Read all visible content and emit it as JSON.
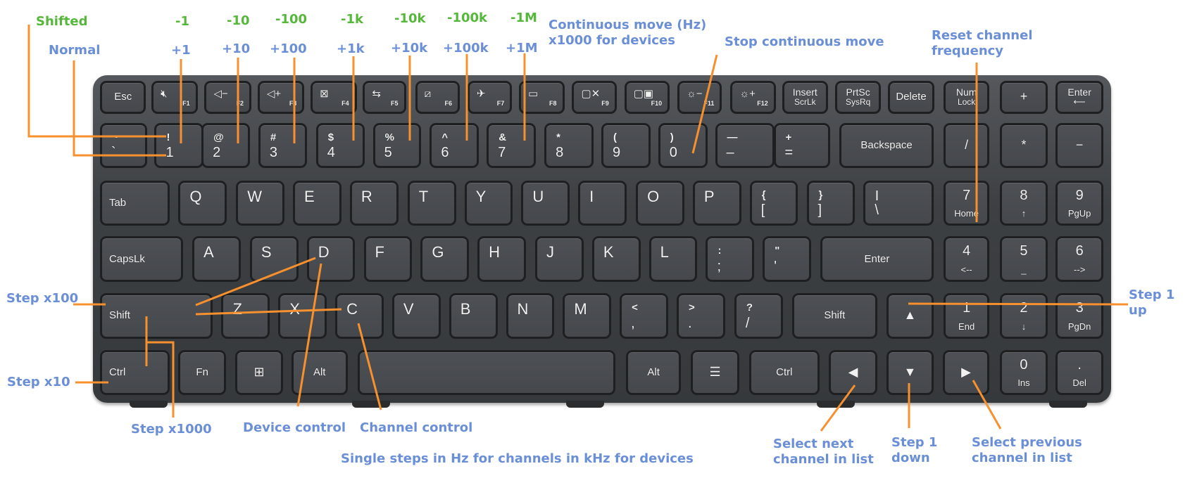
{
  "annotations": {
    "shifted": "Shifted",
    "normal": "Normal",
    "step_values_shifted": [
      "-1",
      "-10",
      "-100",
      "-1k",
      "-10k",
      "-100k",
      "-1M"
    ],
    "step_values_normal": [
      "+1",
      "+10",
      "+100",
      "+1k",
      "+10k",
      "+100k",
      "+1M"
    ],
    "continuous_move_line1": "Continuous move (Hz)",
    "continuous_move_line2": "x1000 for devices",
    "stop_continuous_move": "Stop continuous move",
    "reset_channel_line1": "Reset channel",
    "reset_channel_line2": "frequency",
    "step_x100": "Step x100",
    "step_x10": "Step x10",
    "step_x1000": "Step x1000",
    "device_control": "Device control",
    "channel_control": "Channel control",
    "single_steps": "Single steps in Hz for channels in kHz for devices",
    "select_next_line1": "Select next",
    "select_next_line2": "channel in list",
    "step1_down_line1": "Step 1",
    "step1_down_line2": "down",
    "select_prev_line1": "Select previous",
    "select_prev_line2": "channel in list",
    "step1_up_line1": "Step 1",
    "step1_up_line2": "up"
  },
  "colors": {
    "annotation_blue": "#6a8fd6",
    "annotation_green": "#55b83a",
    "leader_line_orange": "#f7902e",
    "keyboard_body": "#3d4043"
  },
  "keyboard": {
    "keys": [
      {
        "id": "esc",
        "main": "Esc"
      },
      {
        "id": "f1",
        "icon": "mute-icon",
        "glyph": "🔇︎",
        "fn": "F1"
      },
      {
        "id": "f2",
        "icon": "volume-down-icon",
        "glyph": "◁−",
        "fn": "F2"
      },
      {
        "id": "f3",
        "icon": "volume-up-icon",
        "glyph": "◁+",
        "fn": "F3"
      },
      {
        "id": "f4",
        "icon": "close-window-icon",
        "glyph": "⊠",
        "fn": "F4"
      },
      {
        "id": "f5",
        "icon": "refresh-icon",
        "glyph": "⇆",
        "fn": "F5"
      },
      {
        "id": "f6",
        "icon": "touchpad-off-icon",
        "glyph": "⧄",
        "fn": "F6"
      },
      {
        "id": "f7",
        "icon": "airplane-icon",
        "glyph": "✈",
        "fn": "F7"
      },
      {
        "id": "f8",
        "icon": "camera-icon",
        "glyph": "▭",
        "fn": "F8"
      },
      {
        "id": "f9",
        "icon": "display-off-icon",
        "glyph": "▢✕",
        "fn": "F9"
      },
      {
        "id": "f10",
        "icon": "project-display-icon",
        "glyph": "▢▣",
        "fn": "F10"
      },
      {
        "id": "f11",
        "icon": "brightness-down-icon",
        "glyph": "☼−",
        "fn": "F11"
      },
      {
        "id": "f12",
        "icon": "brightness-up-icon",
        "glyph": "☼+",
        "fn": "F12"
      },
      {
        "id": "insert",
        "top": "Insert",
        "bottom": "ScrLk"
      },
      {
        "id": "prtsc",
        "top": "PrtSc",
        "bottom": "SysRq"
      },
      {
        "id": "delete",
        "main": "Delete"
      },
      {
        "id": "numlock",
        "top": "Num",
        "bottom": "Lock"
      },
      {
        "id": "kp-plus",
        "main": "+"
      },
      {
        "id": "kp-enter",
        "top": "Enter",
        "bottom": "⟵"
      },
      {
        "id": "backtick",
        "top": "~",
        "bottom": "`"
      },
      {
        "id": "1",
        "top": "!",
        "bottom": "1"
      },
      {
        "id": "2",
        "top": "@",
        "bottom": "2"
      },
      {
        "id": "3",
        "top": "#",
        "bottom": "3"
      },
      {
        "id": "4",
        "top": "$",
        "bottom": "4"
      },
      {
        "id": "5",
        "top": "%",
        "bottom": "5"
      },
      {
        "id": "6",
        "top": "^",
        "bottom": "6"
      },
      {
        "id": "7",
        "top": "&",
        "bottom": "7"
      },
      {
        "id": "8",
        "top": "*",
        "bottom": "8"
      },
      {
        "id": "9",
        "top": "(",
        "bottom": "9"
      },
      {
        "id": "0",
        "top": ")",
        "bottom": "0"
      },
      {
        "id": "minus",
        "top": "—",
        "bottom": "–"
      },
      {
        "id": "equals",
        "top": "+",
        "bottom": "="
      },
      {
        "id": "backspace",
        "main": "Backspace"
      },
      {
        "id": "kp-slash",
        "main": "/"
      },
      {
        "id": "kp-star",
        "main": "*"
      },
      {
        "id": "kp-minus",
        "main": "−"
      },
      {
        "id": "tab",
        "main": "Tab"
      },
      {
        "id": "q",
        "main": "Q"
      },
      {
        "id": "w",
        "main": "W"
      },
      {
        "id": "e",
        "main": "E"
      },
      {
        "id": "r",
        "main": "R"
      },
      {
        "id": "t",
        "main": "T"
      },
      {
        "id": "y",
        "main": "Y"
      },
      {
        "id": "u",
        "main": "U"
      },
      {
        "id": "i",
        "main": "I"
      },
      {
        "id": "o",
        "main": "O"
      },
      {
        "id": "p",
        "main": "P"
      },
      {
        "id": "lbracket",
        "top": "{",
        "bottom": "["
      },
      {
        "id": "rbracket",
        "top": "}",
        "bottom": "]"
      },
      {
        "id": "backslash",
        "top": "|",
        "bottom": "\\"
      },
      {
        "id": "kp7",
        "top": "7",
        "bottom": "Home"
      },
      {
        "id": "kp8",
        "top": "8",
        "bottom": "↑"
      },
      {
        "id": "kp9",
        "top": "9",
        "bottom": "PgUp"
      },
      {
        "id": "capslock",
        "main": "CapsLk"
      },
      {
        "id": "a",
        "main": "A"
      },
      {
        "id": "s",
        "main": "S"
      },
      {
        "id": "d",
        "main": "D"
      },
      {
        "id": "f",
        "main": "F"
      },
      {
        "id": "g",
        "main": "G"
      },
      {
        "id": "h",
        "main": "H"
      },
      {
        "id": "j",
        "main": "J"
      },
      {
        "id": "k",
        "main": "K"
      },
      {
        "id": "l",
        "main": "L"
      },
      {
        "id": "semicolon",
        "top": ":",
        "bottom": ";"
      },
      {
        "id": "quote",
        "top": "\"",
        "bottom": "'"
      },
      {
        "id": "enter",
        "main": "Enter"
      },
      {
        "id": "kp4",
        "top": "4",
        "bottom": "<--"
      },
      {
        "id": "kp5",
        "top": "5",
        "bottom": "_"
      },
      {
        "id": "kp6",
        "top": "6",
        "bottom": "-->"
      },
      {
        "id": "lshift",
        "main": "Shift"
      },
      {
        "id": "z",
        "main": "Z"
      },
      {
        "id": "x",
        "main": "X"
      },
      {
        "id": "c",
        "main": "C"
      },
      {
        "id": "v",
        "main": "V"
      },
      {
        "id": "b",
        "main": "B"
      },
      {
        "id": "n",
        "main": "N"
      },
      {
        "id": "m",
        "main": "M"
      },
      {
        "id": "comma",
        "top": "<",
        "bottom": ","
      },
      {
        "id": "period",
        "top": ">",
        "bottom": "."
      },
      {
        "id": "slash",
        "top": "?",
        "bottom": "/"
      },
      {
        "id": "rshift",
        "main": "Shift"
      },
      {
        "id": "up",
        "main": "▲"
      },
      {
        "id": "kp1",
        "top": "1",
        "bottom": "End"
      },
      {
        "id": "kp2",
        "top": "2",
        "bottom": "↓"
      },
      {
        "id": "kp3",
        "top": "3",
        "bottom": "PgDn"
      },
      {
        "id": "lctrl",
        "main": "Ctrl"
      },
      {
        "id": "fn",
        "main": "Fn"
      },
      {
        "id": "win",
        "main": "⊞"
      },
      {
        "id": "lalt",
        "main": "Alt"
      },
      {
        "id": "space",
        "main": ""
      },
      {
        "id": "ralt",
        "main": "Alt"
      },
      {
        "id": "menu",
        "main": "☰"
      },
      {
        "id": "rctrl",
        "main": "Ctrl"
      },
      {
        "id": "left",
        "main": "◀"
      },
      {
        "id": "down",
        "main": "▼"
      },
      {
        "id": "right",
        "main": "▶"
      },
      {
        "id": "kp0",
        "top": "0",
        "bottom": "Ins"
      },
      {
        "id": "kp-dot",
        "top": ".",
        "bottom": "Del"
      }
    ]
  }
}
